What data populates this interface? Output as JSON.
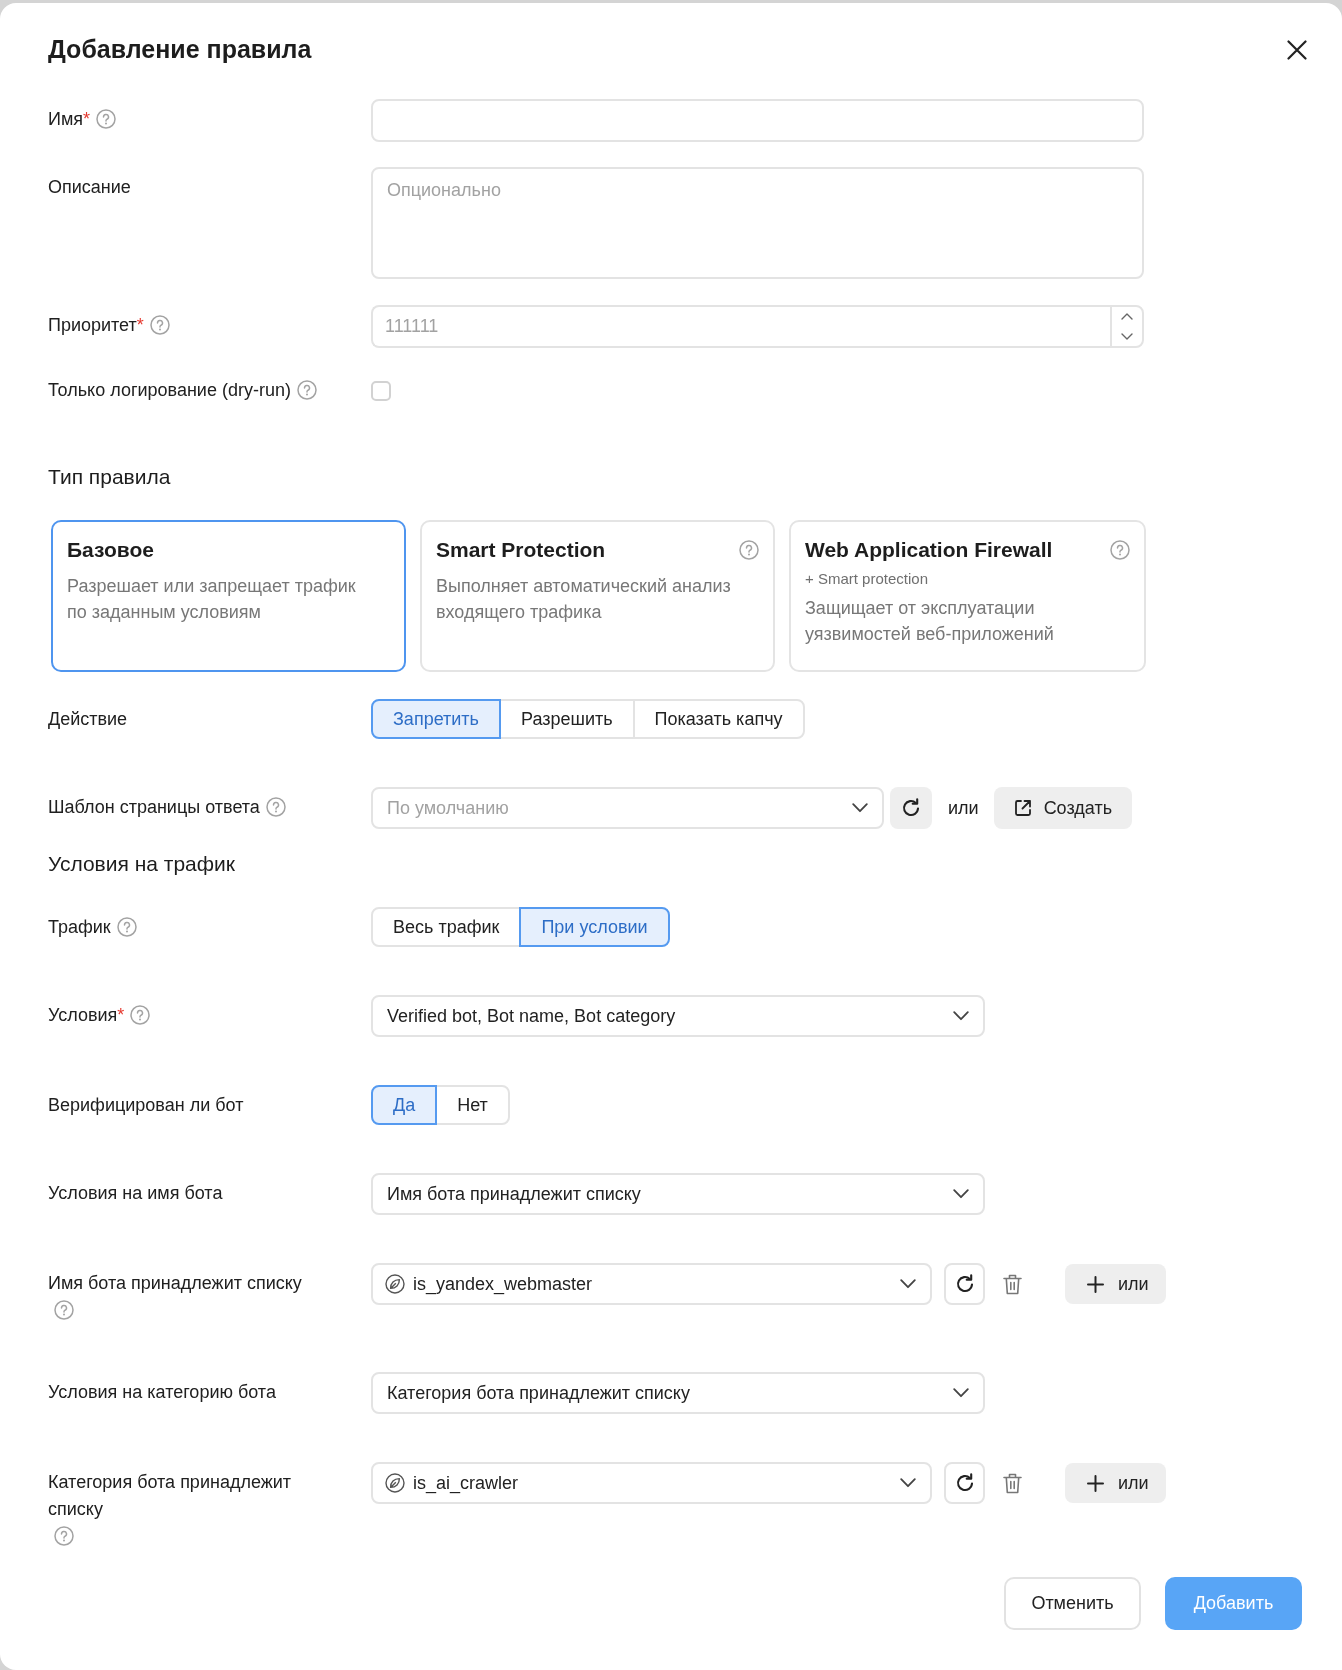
{
  "title": "Добавление правила",
  "sections": [
    {
      "fields": [
        {
          "kind": "text",
          "label": "Имя",
          "required_mark": "*",
          "help": true
        },
        {
          "kind": "textarea",
          "label": "Описание",
          "help": false,
          "placeholder": "Опционально"
        },
        {
          "kind": "number",
          "label": "Приоритет",
          "required_mark": "*",
          "help": true,
          "placeholder": "111111"
        },
        {
          "kind": "checkbox",
          "label": "Только логирование (dry-run)",
          "help": true,
          "checked": false
        }
      ]
    },
    {
      "heading": "Тип правила",
      "rule_types": [
        {
          "title": "Базовое",
          "description": "Разрешает или запрещает трафик по заданным условиям",
          "help": false,
          "selected": true
        },
        {
          "title": "Smart Protection",
          "description": "Выполняет автоматический анализ входящего трафика",
          "help": true,
          "selected": false
        },
        {
          "title": "Web Application Firewall",
          "subtitle": "+ Smart protection",
          "description": "Защищает от эксплуатации уязвимостей веб-приложений",
          "help": true,
          "selected": false
        }
      ],
      "fields": [
        {
          "kind": "segmented",
          "label": "Действие",
          "help": false,
          "options": [
            {
              "label": "Запретить",
              "selected": true
            },
            {
              "label": "Разрешить",
              "selected": false
            },
            {
              "label": "Показать капчу",
              "selected": false
            }
          ]
        },
        {
          "kind": "template_select",
          "label": "Шаблон страницы ответа",
          "help": true,
          "placeholder": "По умолчанию",
          "or_text": "или",
          "create_button": "Создать"
        }
      ]
    },
    {
      "heading": "Условия на трафик",
      "fields": [
        {
          "kind": "segmented",
          "label": "Трафик",
          "help": true,
          "options": [
            {
              "label": "Весь трафик",
              "selected": false
            },
            {
              "label": "При условии",
              "selected": true
            }
          ]
        },
        {
          "kind": "select",
          "label": "Условия",
          "required_mark": "*",
          "help": true,
          "value": "Verified bot, Bot name, Bot category"
        },
        {
          "kind": "segmented",
          "label": "Верифицирован ли бот",
          "help": false,
          "options": [
            {
              "label": "Да",
              "selected": true
            },
            {
              "label": "Нет",
              "selected": false
            }
          ]
        },
        {
          "kind": "select",
          "label": "Условия на имя бота",
          "help": false,
          "value": "Имя бота принадлежит списку"
        },
        {
          "kind": "list_select",
          "label": "Имя бота принадлежит списку",
          "help": true,
          "value": "is_yandex_webmaster",
          "add_button": "или"
        },
        {
          "kind": "select",
          "label": "Условия на категорию бота",
          "help": false,
          "value": "Категория бота принадлежит списку"
        },
        {
          "kind": "list_select",
          "label": "Категория бота принадлежит списку",
          "help": true,
          "value": "is_ai_crawler",
          "add_button": "или"
        }
      ]
    }
  ],
  "footer": {
    "buttons": [
      {
        "kind": "secondary",
        "label": "Отменить"
      },
      {
        "kind": "primary",
        "label": "Добавить"
      }
    ]
  }
}
